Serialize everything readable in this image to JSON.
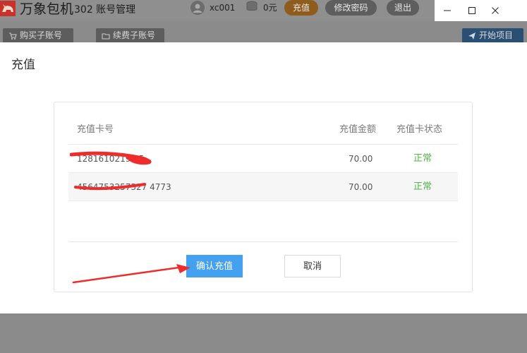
{
  "titlebar": {
    "brand": "万象包机",
    "subtitle": "302 账号管理",
    "username": "xc001",
    "balance": "0元",
    "recharge_label": "充值",
    "change_password_label": "修改密码",
    "logout_label": "退出"
  },
  "toolbar": {
    "buy_label": "购买子账号",
    "renew_label": "续费子账号",
    "start_label": "开始项目"
  },
  "modal": {
    "title": "充值",
    "columns": {
      "card": "充值卡号",
      "amount": "充值金额",
      "status": "充值卡状态"
    },
    "rows": [
      {
        "card": "1281610219      15",
        "amount": "70.00",
        "status": "正常"
      },
      {
        "card": "4564753257327 4773",
        "amount": "70.00",
        "status": "正常"
      }
    ],
    "confirm_label": "确认充值",
    "cancel_label": "取消"
  },
  "colors": {
    "accent_blue": "#44a1f0",
    "status_green": "#52b44a",
    "recharge_pill": "#8e5d1e",
    "annotation_red": "#ef2b2b"
  },
  "icons": {
    "logo": "rhino-logo-icon",
    "avatar": "user-avatar-icon",
    "coin": "coin-stack-icon",
    "cart": "cart-icon",
    "folder": "folder-icon",
    "send": "paper-plane-icon"
  }
}
